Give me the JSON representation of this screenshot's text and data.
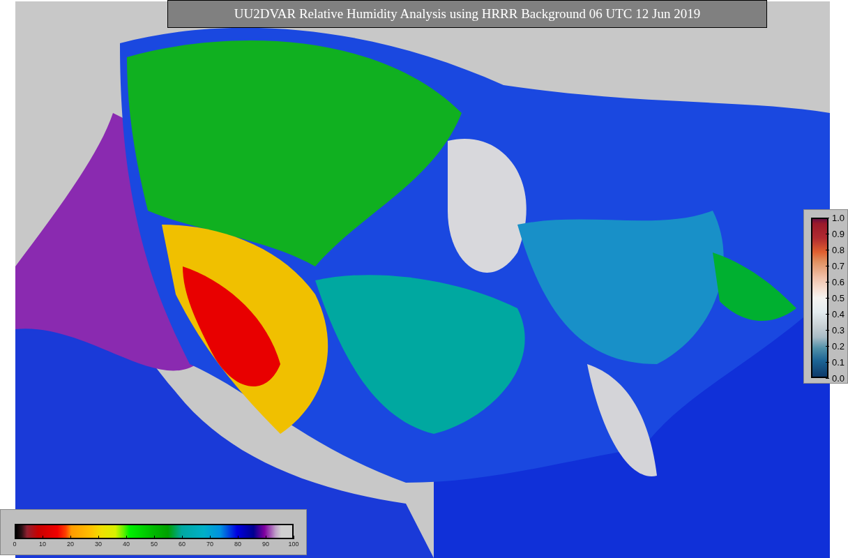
{
  "title": "UU2DVAR Relative Humidity Analysis using HRRR Background 06 UTC 12 Jun 2019",
  "humidity_legend": {
    "ticks": [
      "0",
      "10",
      "20",
      "30",
      "40",
      "50",
      "60",
      "70",
      "80",
      "90",
      "100"
    ]
  },
  "observation_legend": {
    "ticks": [
      "1.0",
      "0.9",
      "0.8",
      "0.7",
      "0.6",
      "0.5",
      "0.4",
      "0.3",
      "0.2",
      "0.1",
      "0.0"
    ]
  }
}
